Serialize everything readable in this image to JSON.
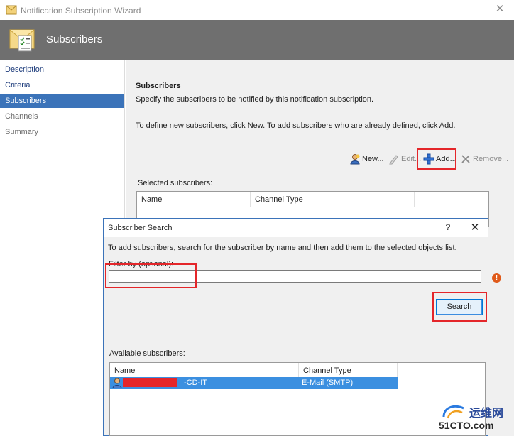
{
  "window": {
    "title": "Notification Subscription Wizard",
    "close_glyph": "✕"
  },
  "header": {
    "title": "Subscribers",
    "icon": "notification-envelope-icon"
  },
  "nav": {
    "items": [
      {
        "label": "Description"
      },
      {
        "label": "Criteria"
      },
      {
        "label": "Subscribers"
      },
      {
        "label": "Channels"
      },
      {
        "label": "Summary"
      }
    ]
  },
  "main": {
    "heading": "Subscribers",
    "description": "Specify the subscribers to be notified by this notification subscription.",
    "instructions": "To define new subscribers, click New.  To add subscribers who are already defined, click Add.",
    "toolbar": {
      "new_label": "New...",
      "edit_label": "Edit...",
      "add_label": "Add...",
      "remove_label": "Remove..."
    },
    "selected_label": "Selected subscribers:",
    "selected_columns": [
      "Name",
      "Channel Type"
    ]
  },
  "dialog": {
    "title": "Subscriber Search",
    "help_glyph": "?",
    "close_glyph": "✕",
    "instructions": "To add subscribers, search for the subscriber by name and then add them to the selected objects list.",
    "filter_label": "Filter by (optional):",
    "filter_value": "",
    "search_label": "Search",
    "error_glyph": "!",
    "available_label": "Available subscribers:",
    "available_columns": [
      "Name",
      "Channel Type"
    ],
    "available_rows": [
      {
        "name": "-CD-IT",
        "channel": "E-Mail (SMTP)"
      }
    ]
  },
  "watermark": {
    "line1": "运维网",
    "line2": "51CTO.com"
  },
  "colors": {
    "accent": "#3b73b9",
    "header_bg": "#6f6f6f",
    "highlight": "#e4262a"
  }
}
